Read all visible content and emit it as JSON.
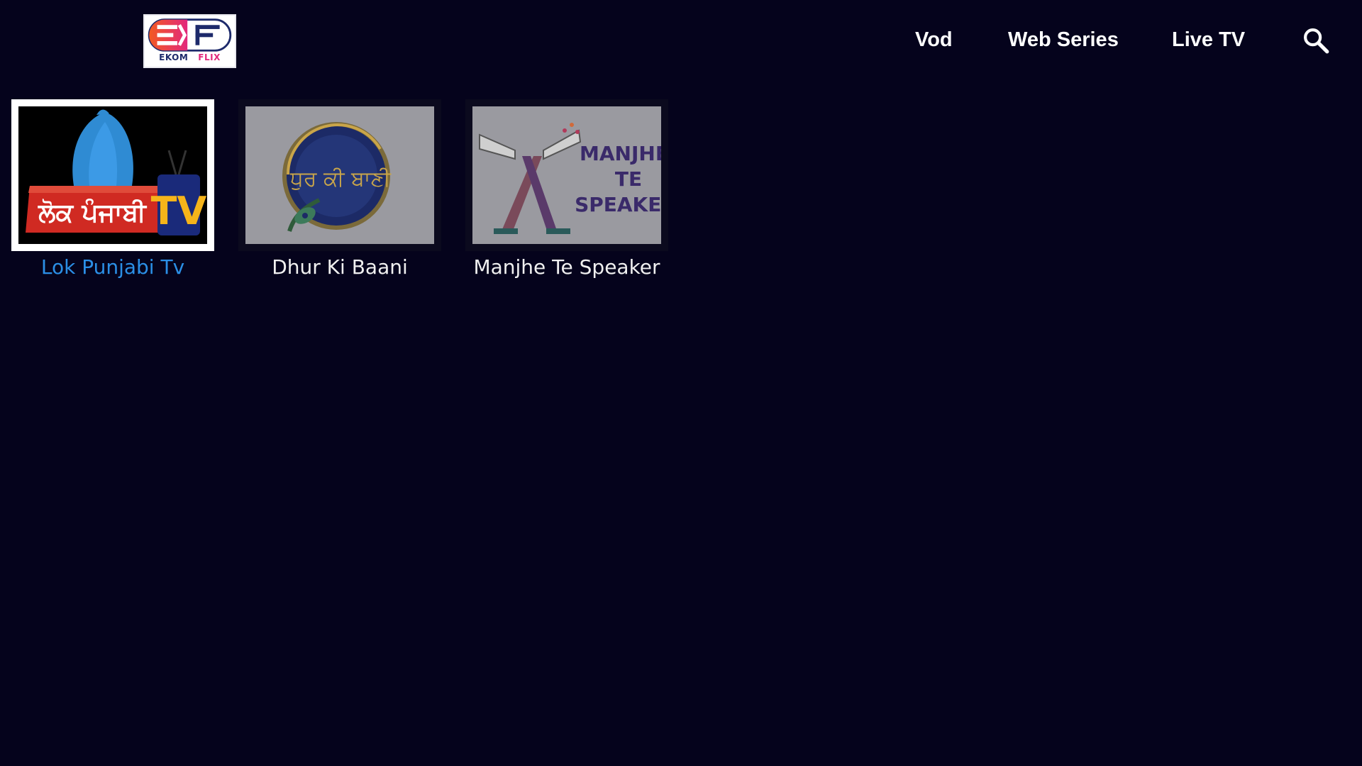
{
  "app": {
    "logo_text_left": "EKOM",
    "logo_text_right": "FLIX",
    "logo_letters": "EF"
  },
  "nav": {
    "items": [
      {
        "label": "Vod"
      },
      {
        "label": "Web Series"
      },
      {
        "label": "Live TV"
      }
    ],
    "search_icon": "search-icon"
  },
  "channels": [
    {
      "title": "Lok Punjabi Tv",
      "thumb_text": "ਲੋਕ ਪੰਜਾਬੀ TV",
      "focused": true
    },
    {
      "title": "Dhur Ki Baani",
      "thumb_text": "ਧੁਰ ਕੀ ਬਾਣੀ",
      "focused": false
    },
    {
      "title": "Manjhe Te Speaker",
      "thumb_text_lines": [
        "MANJHE",
        "TE",
        "SPEAKER"
      ],
      "focused": false
    }
  ],
  "colors": {
    "background": "#05031c",
    "focus_title": "#2b8fe6",
    "focus_border": "#ffffff"
  }
}
